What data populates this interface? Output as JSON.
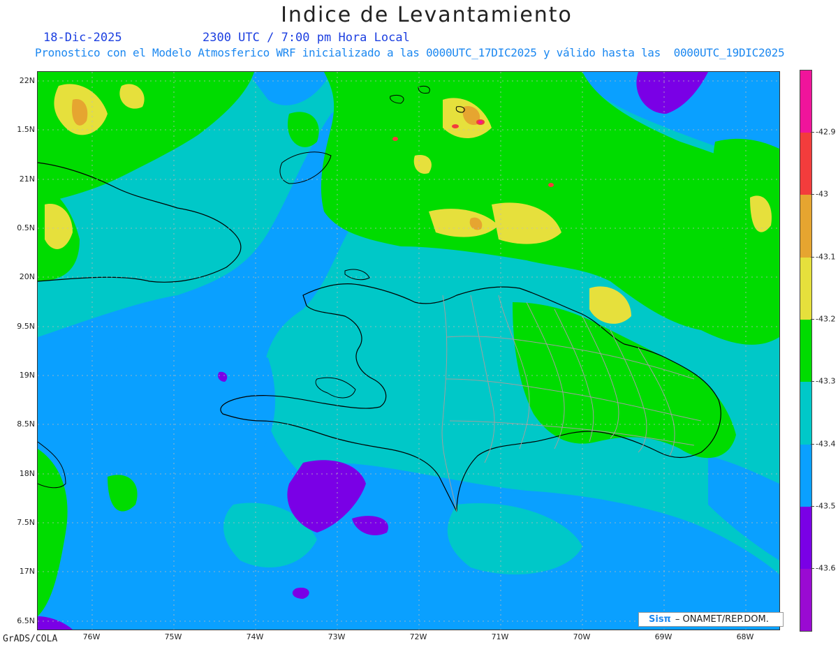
{
  "header": {
    "title": "Indice de Levantamiento",
    "date": "18-Dic-2025",
    "time": "2300 UTC / 7:00 pm Hora Local",
    "model_info": "Pronostico con el Modelo Atmosferico WRF inicializado a las 0000UTC_17DIC2025 y válido hasta las  0000UTC_19DIC2025"
  },
  "axes": {
    "lat_labels": [
      "22N",
      "1.5N",
      "21N",
      "0.5N",
      "20N",
      "9.5N",
      "19N",
      "8.5N",
      "18N",
      "7.5N",
      "17N",
      "6.5N"
    ],
    "lon_labels": [
      "76W",
      "75W",
      "74W",
      "73W",
      "72W",
      "71W",
      "70W",
      "69W",
      "68W"
    ]
  },
  "colorbar": {
    "labels": [
      "-42.9",
      "-43",
      "-43.1",
      "-43.2",
      "-43.3",
      "-43.4",
      "-43.5",
      "-43.6"
    ],
    "colors": [
      "#f0149b",
      "#f33c3c",
      "#e6a530",
      "#e6e03c",
      "#00dc00",
      "#00c8c8",
      "#0aa0ff",
      "#7a00e6",
      "#9a0ad2"
    ]
  },
  "palette": {
    "magenta": "#f0149b",
    "red": "#f33c3c",
    "orange": "#e6a530",
    "yellow": "#e6e03c",
    "green": "#00dc00",
    "cyan": "#00c8c8",
    "blue": "#0aa0ff",
    "violet": "#7a00e6",
    "purple": "#9a0ad2",
    "coast": "#000000",
    "provinces": "#a0a0a0"
  },
  "footer": {
    "software": "GrADS/COLA",
    "credit_brand": "Sisπ",
    "credit_text": "– ONAMET/REP.DOM."
  }
}
